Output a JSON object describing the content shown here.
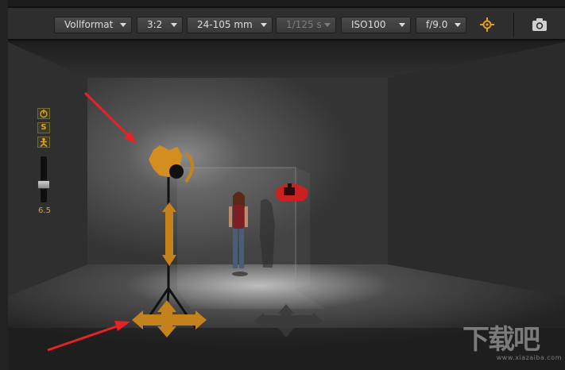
{
  "toolbar": {
    "format": "Vollformat",
    "aspect": "3:2",
    "lens": "24-105 mm",
    "shutter": "1/125 s",
    "iso": "ISO100",
    "aperture": "f/9.0",
    "focus_icon": "crosshair-focus-icon",
    "camera_icon": "camera-icon"
  },
  "side_panel": {
    "power_icon": "power-icon",
    "s_label": "S",
    "person_icon": "person-icon",
    "slider_value": "6.5",
    "slider_level": 0.6
  },
  "watermark": {
    "text": "下载吧",
    "url": "www.xiazaiba.com"
  },
  "colors": {
    "accent": "#e0a21e",
    "toolbar_bg": "#2e2e2e",
    "camera_marker": "#d91c1c",
    "arrow": "#e42323"
  }
}
